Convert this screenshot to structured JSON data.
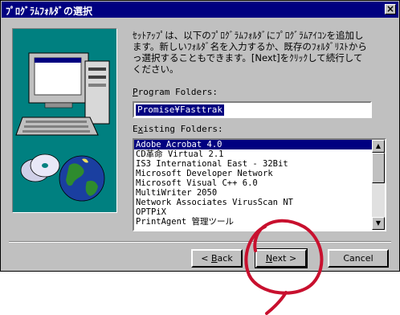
{
  "window": {
    "title": "ﾌﾟﾛｸﾞﾗﾑﾌｫﾙﾀﾞの選択",
    "close_glyph": "×"
  },
  "description": "ｾｯﾄｱｯﾌﾟは、以下のﾌﾟﾛｸﾞﾗﾑﾌｫﾙﾀﾞにﾌﾟﾛｸﾞﾗﾑｱｲｺﾝを追加し\nます。新しいﾌｫﾙﾀﾞ名を入力するか、既存のﾌｫﾙﾀﾞﾘｽﾄから\nっ選択することもできます。[Next]をｸﾘｯｸして続行して\nください。",
  "program_folders": {
    "label_mnemonic": "P",
    "label_rest": "rogram Folders:",
    "value": "Promise¥Fasttrak"
  },
  "existing_folders": {
    "label_pre": "E",
    "label_mnemonic": "x",
    "label_rest": "isting Folders:",
    "items": [
      "Adobe Acrobat 4.0",
      "CD革命 Virtual 2.1",
      "IS3 International East - 32Bit",
      "Microsoft Developer Network",
      "Microsoft Visual C++ 6.0",
      "MultiWriter 2050",
      "Network Associates VirusScan NT",
      "OPTPiX",
      "PrintAgent 管理ツール"
    ],
    "selected_index": 0
  },
  "scroll_up_glyph": "▲",
  "scroll_down_glyph": "▼",
  "buttons": {
    "back": {
      "prefix": "< ",
      "mnemonic": "B",
      "rest": "ack"
    },
    "next": {
      "mnemonic": "N",
      "rest": "ext >"
    },
    "cancel": {
      "label": "Cancel"
    }
  },
  "annotation": {
    "color": "#c8102e",
    "shape": "circle-with-tail"
  }
}
